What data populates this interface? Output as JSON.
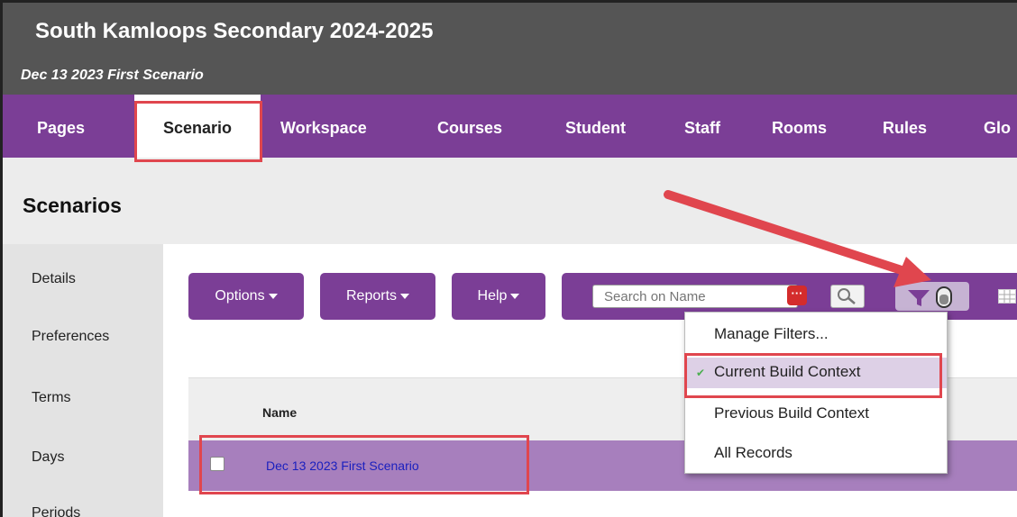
{
  "header": {
    "school": "South Kamloops Secondary 2024-2025",
    "scenario": "Dec 13 2023 First Scenario"
  },
  "nav": {
    "tabs": [
      "Pages",
      "Scenario",
      "Workspace",
      "Courses",
      "Student",
      "Staff",
      "Rooms",
      "Rules",
      "Glo"
    ],
    "active": "Scenario"
  },
  "page": {
    "title": "Scenarios"
  },
  "sidebar": {
    "items": [
      "Details",
      "Preferences",
      "Terms",
      "Days",
      "Periods"
    ]
  },
  "toolbar": {
    "options_label": "Options",
    "reports_label": "Reports",
    "help_label": "Help",
    "search_placeholder": "Search on Name"
  },
  "filter_menu": {
    "items": [
      "Manage Filters...",
      "Current Build Context",
      "Previous Build Context",
      "All Records"
    ],
    "selected": "Current Build Context"
  },
  "table": {
    "columns": [
      "Name"
    ],
    "rows": [
      {
        "name": "Dec 13 2023 First Scenario"
      }
    ]
  },
  "colors": {
    "brand_purple": "#7b3e96",
    "selected_row": "#a77fbd",
    "highlight": "#e0464e",
    "header_gray": "#555555"
  },
  "icons": [
    "dots-icon",
    "magnifier-icon",
    "filter-icon",
    "toggle-icon",
    "grid-icon",
    "check-icon",
    "caret-down-icon",
    "arrow-annotation"
  ]
}
